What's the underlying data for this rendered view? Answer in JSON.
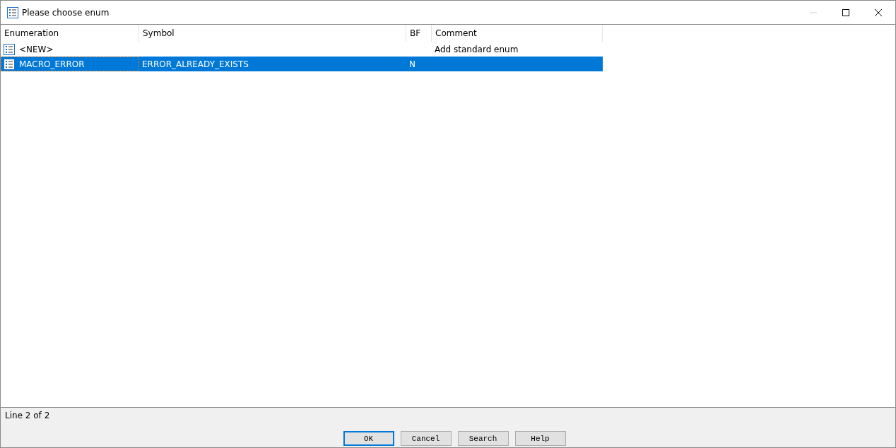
{
  "window": {
    "title": "Please choose enum"
  },
  "table": {
    "columns": [
      "Enumeration",
      "Symbol",
      "BF",
      "Comment"
    ],
    "rows": [
      {
        "cells": [
          "<NEW>",
          "",
          "",
          "Add standard enum"
        ],
        "selected": false
      },
      {
        "cells": [
          "MACRO_ERROR",
          "ERROR_ALREADY_EXISTS",
          "N",
          ""
        ],
        "selected": true
      }
    ]
  },
  "status_bar": {
    "text": "Line 2 of 2"
  },
  "buttons": [
    {
      "label": "OK",
      "selected": true
    },
    {
      "label": "Cancel",
      "selected": false
    },
    {
      "label": "Search",
      "selected": false
    },
    {
      "label": "Help",
      "selected": false
    }
  ]
}
